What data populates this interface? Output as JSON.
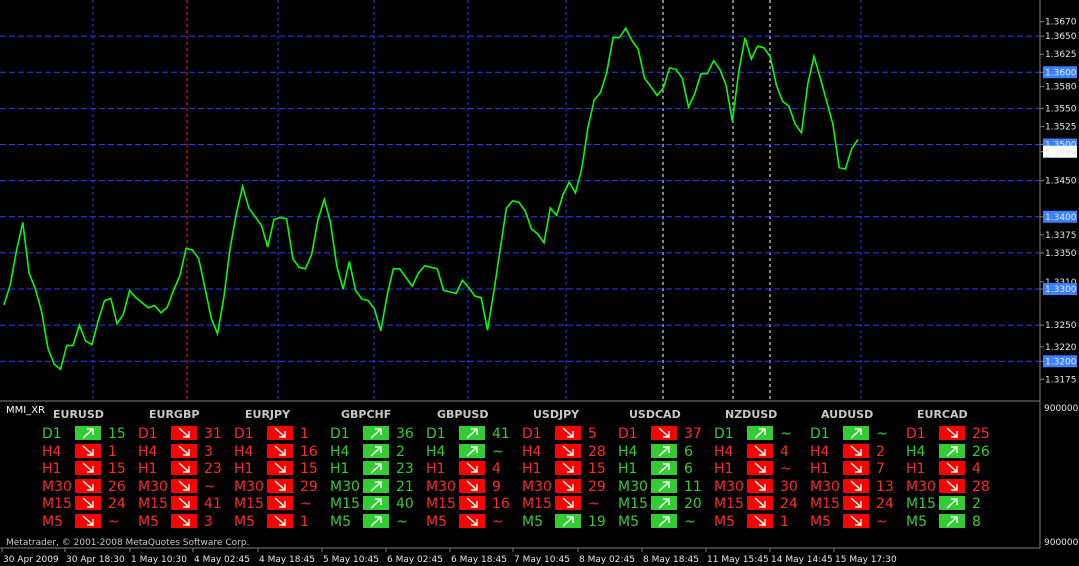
{
  "chart": {
    "symbol": "EURUSD",
    "colors": {
      "background": "#000000",
      "price_line": "#00ff00",
      "grid_h": "#2a3cff",
      "grid_v_blue": "#2a3cff",
      "grid_v_white": "#ffffff",
      "grid_v_red": "#ff2a2a",
      "axis_text": "#e8e8e8",
      "highlight_badge": "#3a80ff"
    },
    "price_labels": [
      {
        "text": "1.3670",
        "value": 1.367,
        "highlight": false
      },
      {
        "text": "1.3650",
        "value": 1.365,
        "highlight": false
      },
      {
        "text": "1.3625",
        "value": 1.3625,
        "highlight": false
      },
      {
        "text": "1.3600",
        "value": 1.36,
        "highlight": true
      },
      {
        "text": "1.3580",
        "value": 1.358,
        "highlight": false
      },
      {
        "text": "1.3550",
        "value": 1.355,
        "highlight": false
      },
      {
        "text": "1.3525",
        "value": 1.3525,
        "highlight": false
      },
      {
        "text": "1.3500",
        "value": 1.35,
        "highlight": true
      },
      {
        "text": "1.3490",
        "value": 1.349,
        "highlight": false,
        "current": true
      },
      {
        "text": "1.3450",
        "value": 1.345,
        "highlight": false
      },
      {
        "text": "1.3400",
        "value": 1.34,
        "highlight": true
      },
      {
        "text": "1.3375",
        "value": 1.3375,
        "highlight": false
      },
      {
        "text": "1.3350",
        "value": 1.335,
        "highlight": false
      },
      {
        "text": "1.3310",
        "value": 1.331,
        "highlight": false
      },
      {
        "text": "1.3300",
        "value": 1.33,
        "highlight": true
      },
      {
        "text": "1.3250",
        "value": 1.325,
        "highlight": false
      },
      {
        "text": "1.3220",
        "value": 1.322,
        "highlight": false
      },
      {
        "text": "1.3200",
        "value": 1.32,
        "highlight": true
      },
      {
        "text": "1.3175",
        "value": 1.3175,
        "highlight": false
      }
    ],
    "price_range": [
      1.3145,
      1.37
    ],
    "date_labels": [
      "30 Apr 2009",
      "30 Apr 18:30",
      "1 May 10:30",
      "4 May 02:45",
      "4 May 18:45",
      "5 May 10:45",
      "6 May 02:45",
      "6 May 18:45",
      "7 May 10:45",
      "8 May 02:45",
      "8 May 18:45",
      "11 May 15:45",
      "14 May 14:45",
      "15 May 17:30"
    ],
    "series": [
      1.329,
      1.331,
      1.335,
      1.338,
      1.333,
      1.33,
      1.326,
      1.323,
      1.32,
      1.3185,
      1.321,
      1.323,
      1.325,
      1.322,
      1.3235,
      1.326,
      1.328,
      1.3275,
      1.326,
      1.3265,
      1.329,
      1.33,
      1.3285,
      1.327,
      1.3265,
      1.3275,
      1.3275,
      1.329,
      1.333,
      1.336,
      1.335,
      1.333,
      1.331,
      1.326,
      1.323,
      1.33,
      1.336,
      1.34,
      1.343,
      1.342,
      1.34,
      1.338,
      1.337,
      1.34,
      1.3395,
      1.3385,
      1.335,
      1.333,
      1.332,
      1.336,
      1.34,
      1.342,
      1.338,
      1.334,
      1.33,
      1.333,
      1.331,
      1.329,
      1.328,
      1.326,
      1.325,
      1.329,
      1.332,
      1.334,
      1.332,
      1.33,
      1.331,
      1.334,
      1.333,
      1.332,
      1.331,
      1.33,
      1.329,
      1.33,
      1.331,
      1.329,
      1.328,
      1.3255,
      1.33,
      1.335,
      1.34,
      1.343,
      1.342,
      1.34,
      1.3395,
      1.338,
      1.336,
      1.34,
      1.341,
      1.343,
      1.344,
      1.3445,
      1.347,
      1.352,
      1.355,
      1.358,
      1.36,
      1.364,
      1.366,
      1.3665,
      1.364,
      1.362,
      1.36,
      1.358,
      1.356,
      1.359,
      1.361,
      1.36,
      1.358,
      1.356,
      1.357,
      1.359,
      1.361,
      1.362,
      1.36,
      1.357,
      1.354,
      1.36,
      1.364,
      1.363,
      1.364,
      1.363,
      1.361,
      1.359,
      1.356,
      1.3545,
      1.354,
      1.352,
      1.358,
      1.361,
      1.36,
      1.356,
      1.352,
      1.348,
      1.347,
      1.349,
      1.3495
    ]
  },
  "indicator": {
    "name": "MMI_XR",
    "scale_top": "9000000",
    "scale_bottom": "9000000",
    "copyright": "Metatrader, © 2001-2008 MetaQuotes Software Corp.",
    "colors": {
      "up": "#33cc33",
      "down": "#ff0000",
      "arrow": "#ffffff",
      "up_text": "#33cc33",
      "down_text": "#ff2a2a"
    },
    "timeframes": [
      "D1",
      "H4",
      "H1",
      "M30",
      "M15",
      "M5"
    ],
    "pairs": [
      {
        "name": "EURUSD",
        "rows": [
          {
            "dir": "up",
            "val": "15"
          },
          {
            "dir": "down",
            "val": "1"
          },
          {
            "dir": "down",
            "val": "15"
          },
          {
            "dir": "down",
            "val": "26"
          },
          {
            "dir": "down",
            "val": "24"
          },
          {
            "dir": "down",
            "val": "~"
          }
        ]
      },
      {
        "name": "EURGBP",
        "rows": [
          {
            "dir": "down",
            "val": "31"
          },
          {
            "dir": "down",
            "val": "3"
          },
          {
            "dir": "down",
            "val": "23"
          },
          {
            "dir": "down",
            "val": "~"
          },
          {
            "dir": "down",
            "val": "41"
          },
          {
            "dir": "down",
            "val": "3"
          }
        ]
      },
      {
        "name": "EURJPY",
        "rows": [
          {
            "dir": "down",
            "val": "1"
          },
          {
            "dir": "down",
            "val": "16"
          },
          {
            "dir": "down",
            "val": "15"
          },
          {
            "dir": "down",
            "val": "29"
          },
          {
            "dir": "down",
            "val": "~"
          },
          {
            "dir": "down",
            "val": "1"
          }
        ]
      },
      {
        "name": "GBPCHF",
        "rows": [
          {
            "dir": "up",
            "val": "36"
          },
          {
            "dir": "up",
            "val": "2"
          },
          {
            "dir": "up",
            "val": "23"
          },
          {
            "dir": "up",
            "val": "21"
          },
          {
            "dir": "up",
            "val": "40"
          },
          {
            "dir": "up",
            "val": "~"
          }
        ]
      },
      {
        "name": "GBPUSD",
        "rows": [
          {
            "dir": "up",
            "val": "41"
          },
          {
            "dir": "up",
            "val": "~"
          },
          {
            "dir": "down",
            "val": "4"
          },
          {
            "dir": "down",
            "val": "9"
          },
          {
            "dir": "down",
            "val": "16"
          },
          {
            "dir": "down",
            "val": "~"
          }
        ]
      },
      {
        "name": "USDJPY",
        "rows": [
          {
            "dir": "down",
            "val": "5"
          },
          {
            "dir": "down",
            "val": "28"
          },
          {
            "dir": "down",
            "val": "15"
          },
          {
            "dir": "down",
            "val": "29"
          },
          {
            "dir": "down",
            "val": "~"
          },
          {
            "dir": "up",
            "val": "19"
          }
        ]
      },
      {
        "name": "USDCAD",
        "rows": [
          {
            "dir": "down",
            "val": "37"
          },
          {
            "dir": "up",
            "val": "6"
          },
          {
            "dir": "up",
            "val": "6"
          },
          {
            "dir": "up",
            "val": "11"
          },
          {
            "dir": "up",
            "val": "20"
          },
          {
            "dir": "up",
            "val": "~"
          }
        ]
      },
      {
        "name": "NZDUSD",
        "rows": [
          {
            "dir": "up",
            "val": "~"
          },
          {
            "dir": "down",
            "val": "4"
          },
          {
            "dir": "down",
            "val": "~"
          },
          {
            "dir": "down",
            "val": "30"
          },
          {
            "dir": "down",
            "val": "24"
          },
          {
            "dir": "down",
            "val": "1"
          }
        ]
      },
      {
        "name": "AUDUSD",
        "rows": [
          {
            "dir": "up",
            "val": "~"
          },
          {
            "dir": "down",
            "val": "2"
          },
          {
            "dir": "down",
            "val": "7"
          },
          {
            "dir": "down",
            "val": "13"
          },
          {
            "dir": "down",
            "val": "24"
          },
          {
            "dir": "down",
            "val": "~"
          }
        ]
      },
      {
        "name": "EURCAD",
        "rows": [
          {
            "dir": "down",
            "val": "25"
          },
          {
            "dir": "up",
            "val": "26"
          },
          {
            "dir": "down",
            "val": "4"
          },
          {
            "dir": "down",
            "val": "28"
          },
          {
            "dir": "up",
            "val": "2"
          },
          {
            "dir": "up",
            "val": "8"
          }
        ]
      }
    ]
  }
}
